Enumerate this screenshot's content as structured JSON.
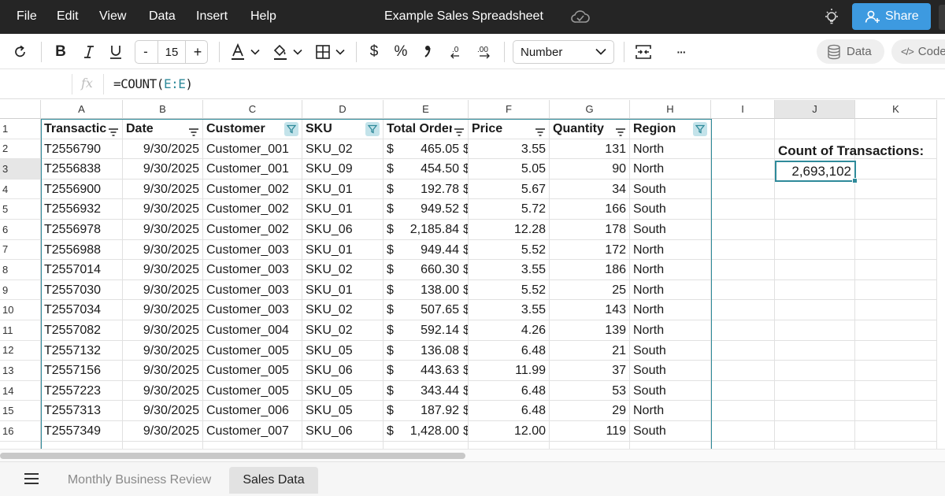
{
  "menu": {
    "items": [
      "File",
      "Edit",
      "View",
      "Data",
      "Insert",
      "Help"
    ],
    "doc_title": "Example Sales Spreadsheet",
    "share_label": "Share"
  },
  "toolbar": {
    "font_size": "15",
    "minus": "-",
    "plus": "+",
    "currency": "$",
    "percent": "%",
    "number_format": "Number",
    "data_label": "Data",
    "code_symbol": "</>",
    "code_label": "Code",
    "more": "···"
  },
  "formula_bar": {
    "fx": "fx",
    "formula_prefix": "=COUNT(",
    "formula_ref": "E:E",
    "formula_suffix": ")"
  },
  "grid": {
    "columns": [
      "A",
      "B",
      "C",
      "D",
      "E",
      "F",
      "G",
      "H",
      "I",
      "J",
      "K"
    ],
    "selected_column": "J",
    "selected_row": "3",
    "headers": [
      "Transactic",
      "Date",
      "Customer",
      "SKU",
      "Total Order",
      "Price",
      "Quantity",
      "Region"
    ],
    "rows": [
      {
        "num": "2",
        "id": "T2556790",
        "date": "9/30/2025",
        "customer": "Customer_001",
        "sku": "SKU_02",
        "total": "465.05",
        "price": "3.55",
        "qty": "131",
        "region": "North"
      },
      {
        "num": "3",
        "id": "T2556838",
        "date": "9/30/2025",
        "customer": "Customer_001",
        "sku": "SKU_09",
        "total": "454.50",
        "price": "5.05",
        "qty": "90",
        "region": "North"
      },
      {
        "num": "4",
        "id": "T2556900",
        "date": "9/30/2025",
        "customer": "Customer_002",
        "sku": "SKU_01",
        "total": "192.78",
        "price": "5.67",
        "qty": "34",
        "region": "South"
      },
      {
        "num": "5",
        "id": "T2556932",
        "date": "9/30/2025",
        "customer": "Customer_002",
        "sku": "SKU_01",
        "total": "949.52",
        "price": "5.72",
        "qty": "166",
        "region": "South"
      },
      {
        "num": "6",
        "id": "T2556978",
        "date": "9/30/2025",
        "customer": "Customer_002",
        "sku": "SKU_06",
        "total": "2,185.84",
        "price": "12.28",
        "qty": "178",
        "region": "South"
      },
      {
        "num": "7",
        "id": "T2556988",
        "date": "9/30/2025",
        "customer": "Customer_003",
        "sku": "SKU_01",
        "total": "949.44",
        "price": "5.52",
        "qty": "172",
        "region": "North"
      },
      {
        "num": "8",
        "id": "T2557014",
        "date": "9/30/2025",
        "customer": "Customer_003",
        "sku": "SKU_02",
        "total": "660.30",
        "price": "3.55",
        "qty": "186",
        "region": "North"
      },
      {
        "num": "9",
        "id": "T2557030",
        "date": "9/30/2025",
        "customer": "Customer_003",
        "sku": "SKU_01",
        "total": "138.00",
        "price": "5.52",
        "qty": "25",
        "region": "North"
      },
      {
        "num": "10",
        "id": "T2557034",
        "date": "9/30/2025",
        "customer": "Customer_003",
        "sku": "SKU_02",
        "total": "507.65",
        "price": "3.55",
        "qty": "143",
        "region": "North"
      },
      {
        "num": "11",
        "id": "T2557082",
        "date": "9/30/2025",
        "customer": "Customer_004",
        "sku": "SKU_02",
        "total": "592.14",
        "price": "4.26",
        "qty": "139",
        "region": "North"
      },
      {
        "num": "12",
        "id": "T2557132",
        "date": "9/30/2025",
        "customer": "Customer_005",
        "sku": "SKU_05",
        "total": "136.08",
        "price": "6.48",
        "qty": "21",
        "region": "South"
      },
      {
        "num": "13",
        "id": "T2557156",
        "date": "9/30/2025",
        "customer": "Customer_005",
        "sku": "SKU_06",
        "total": "443.63",
        "price": "11.99",
        "qty": "37",
        "region": "South"
      },
      {
        "num": "14",
        "id": "T2557223",
        "date": "9/30/2025",
        "customer": "Customer_005",
        "sku": "SKU_05",
        "total": "343.44",
        "price": "6.48",
        "qty": "53",
        "region": "South"
      },
      {
        "num": "15",
        "id": "T2557313",
        "date": "9/30/2025",
        "customer": "Customer_006",
        "sku": "SKU_05",
        "total": "187.92",
        "price": "6.48",
        "qty": "29",
        "region": "North"
      },
      {
        "num": "16",
        "id": "T2557349",
        "date": "9/30/2025",
        "customer": "Customer_007",
        "sku": "SKU_06",
        "total": "1,428.00",
        "price": "12.00",
        "qty": "119",
        "region": "South"
      }
    ],
    "currency_symbol": "$",
    "count_label": "Count of Transactions:",
    "count_value": "2,693,102"
  },
  "sheets": {
    "tabs": [
      "Monthly Business Review",
      "Sales Data"
    ],
    "active": "Sales Data"
  },
  "colors": {
    "menubar": "#252525",
    "accent": "#2f8a9a",
    "share": "#3d9ae0"
  }
}
